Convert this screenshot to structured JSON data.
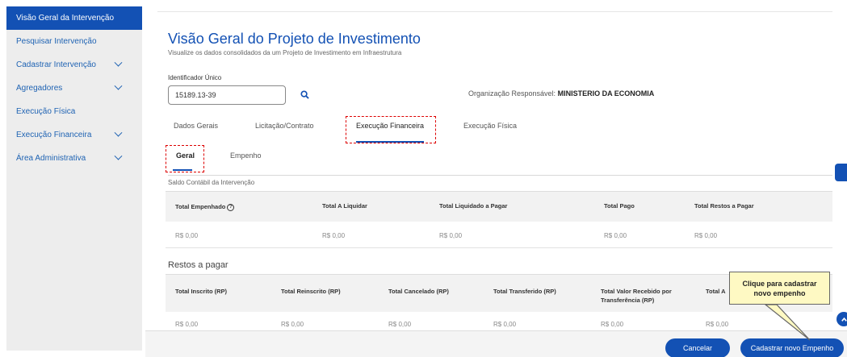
{
  "sidebar": {
    "items": [
      {
        "label": "Visão Geral da Intervenção",
        "active": true,
        "chevron": false
      },
      {
        "label": "Pesquisar Intervenção",
        "active": false,
        "chevron": false
      },
      {
        "label": "Cadastrar Intervenção",
        "active": false,
        "chevron": true
      },
      {
        "label": "Agregadores",
        "active": false,
        "chevron": true
      },
      {
        "label": "Execução Física",
        "active": false,
        "chevron": false
      },
      {
        "label": "Execução Financeira",
        "active": false,
        "chevron": true
      },
      {
        "label": "Área Administrativa",
        "active": false,
        "chevron": true
      }
    ]
  },
  "header": {
    "title": "Visão Geral do Projeto de Investimento",
    "subtitle": "Visualize os dados consolidados da um Projeto de Investimento em Infraestrutura"
  },
  "identifier": {
    "label": "Identificador Único",
    "value": "15189.13-39"
  },
  "organization": {
    "label": "Organização Responsável:",
    "value": "MINISTERIO DA ECONOMIA"
  },
  "tabs": [
    "Dados Gerais",
    "Licitação/Contrato",
    "Execução Financeira",
    "Execução Física"
  ],
  "subtabs": [
    "Geral",
    "Empenho"
  ],
  "saldo_label": "Saldo Contábil da Intervenção",
  "table1": {
    "headers": [
      "Total Empenhado",
      "Total A Liquidar",
      "Total Liquidado a Pagar",
      "Total Pago",
      "Total Restos a Pagar"
    ],
    "help_icon": "?",
    "values": [
      "R$ 0,00",
      "R$ 0,00",
      "R$ 0,00",
      "R$ 0,00",
      "R$ 0,00"
    ]
  },
  "restos_title": "Restos a pagar",
  "table2": {
    "headers": [
      "Total Inscrito (RP)",
      "Total Reinscrito (RP)",
      "Total Cancelado (RP)",
      "Total Transferido (RP)",
      "Total Valor Recebido por",
      "Transferência (RP)",
      "Total A"
    ],
    "values": [
      "R$ 0,00",
      "R$ 0,00",
      "R$ 0,00",
      "R$ 0,00",
      "R$ 0,00",
      "R$ 0,00"
    ]
  },
  "footer": {
    "cancel_label": "Cancelar",
    "new_label": "Cadastrar novo Empenho"
  },
  "callout": {
    "line1": "Clique para cadastrar",
    "line2": "novo empenho"
  },
  "colors": {
    "primary": "#1351b4",
    "callout_bg": "#fef9c3",
    "highlight": "#dd0000"
  },
  "icons": {
    "search": "search-icon",
    "chevron": "chevron-down-icon",
    "help": "help-icon",
    "scroll_up": "chevron-up-icon"
  }
}
